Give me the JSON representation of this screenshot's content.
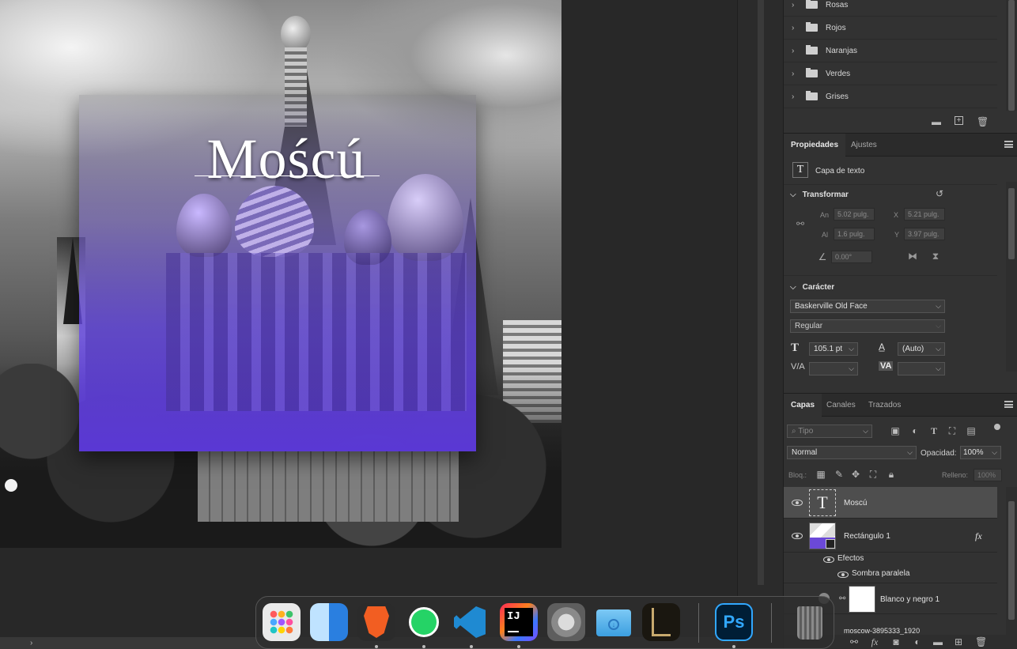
{
  "canvas": {
    "title_text": "Moścú"
  },
  "swatches": {
    "folders": [
      {
        "label": "Rosas"
      },
      {
        "label": "Rojos"
      },
      {
        "label": "Naranjas"
      },
      {
        "label": "Verdes"
      },
      {
        "label": "Grises"
      }
    ]
  },
  "properties": {
    "tabs": [
      "Propiedades",
      "Ajustes"
    ],
    "layer_type": "Capa de texto",
    "transform": {
      "heading": "Transformar",
      "w_label": "An",
      "w_value": "5.02 pulg.",
      "x_label": "X",
      "x_value": "5.21 pulg.",
      "h_label": "Al",
      "h_value": "1.6 pulg.",
      "y_label": "Y",
      "y_value": "3.97 pulg.",
      "angle_value": "0.00°"
    },
    "character": {
      "heading": "Carácter",
      "font_family": "Baskerville Old Face",
      "font_style": "Regular",
      "font_size": "105.1 pt",
      "leading": "(Auto)",
      "kerning_label": "V/A",
      "tracking_label": "VA"
    }
  },
  "layers_panel": {
    "tabs": [
      "Capas",
      "Canales",
      "Trazados"
    ],
    "filter_placeholder": "Tipo",
    "blend_mode": "Normal",
    "opacity_label": "Opacidad:",
    "opacity_value": "100%",
    "lock_label": "Bloq.:",
    "fill_label": "Relleno:",
    "fill_value": "100%",
    "layers": [
      {
        "name": "Moscú"
      },
      {
        "name": "Rectángulo 1",
        "fx": "fx"
      },
      {
        "name": "Blanco y negro 1"
      },
      {
        "name": "moscow-3895333_1920"
      }
    ],
    "effects_label": "Efectos",
    "effect_item": "Sombra paralela"
  },
  "dock": {
    "apps": [
      {
        "name": "Launchpad",
        "color": "#e8e8e8"
      },
      {
        "name": "Finder",
        "color": "#3d8fe8"
      },
      {
        "name": "Brave",
        "color": "#f25e22"
      },
      {
        "name": "WhatsApp",
        "color": "#25d366"
      },
      {
        "name": "Visual Studio Code",
        "color": "#1f8ad2"
      },
      {
        "name": "IntelliJ IDEA",
        "color": "#111111"
      },
      {
        "name": "System Preferences",
        "color": "#8a8a8a"
      },
      {
        "name": "Downloads",
        "color": "#5cb6ec"
      },
      {
        "name": "League of Legends",
        "color": "#2a2417"
      },
      {
        "name": "Photoshop",
        "color": "#001e36",
        "label": "Ps"
      },
      {
        "name": "Trash",
        "color": "#6e6e6e"
      }
    ]
  }
}
